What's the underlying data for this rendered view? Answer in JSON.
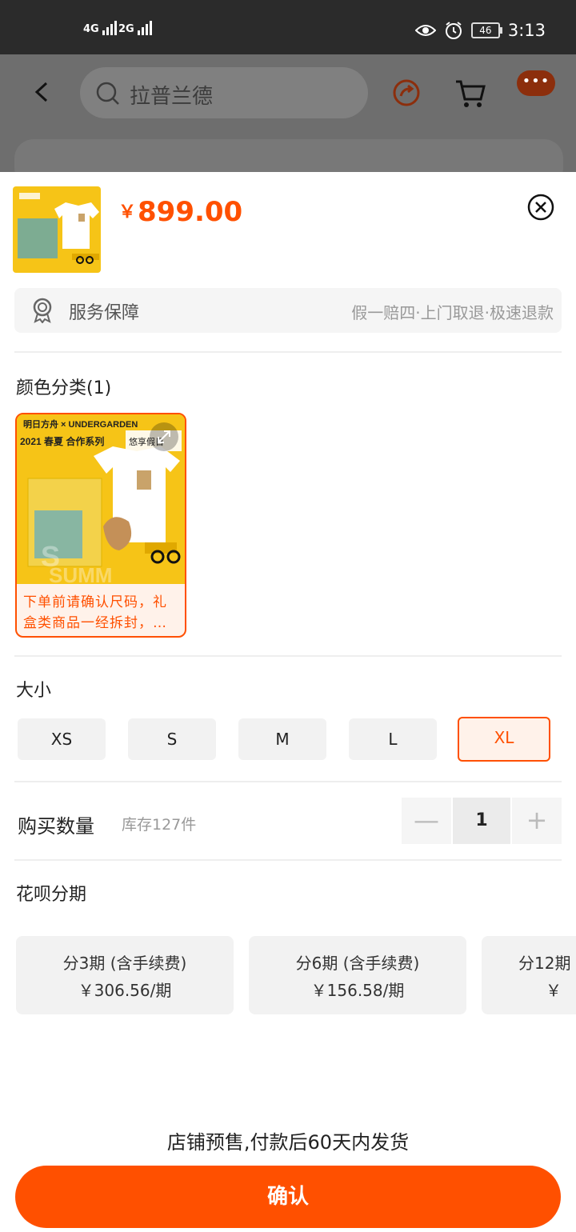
{
  "status_bar": {
    "net1": "4G",
    "net2": "2G",
    "battery": "46",
    "time": "3:13"
  },
  "bg_page": {
    "search_text": "拉普兰德"
  },
  "product": {
    "currency": "￥",
    "price": "899.00"
  },
  "service": {
    "label": "服务保障",
    "detail": "假一赔四·上门取退·极速退款"
  },
  "color": {
    "title": "颜色分类(1)",
    "option_text": "下单前请确认尺码，礼盒类商品一经拆封，…"
  },
  "size": {
    "title": "大小",
    "options": [
      "XS",
      "S",
      "M",
      "L",
      "XL"
    ],
    "selected": "XL"
  },
  "quantity": {
    "label": "购买数量",
    "stock": "库存127件",
    "value": "1",
    "minus": "—",
    "plus": "+"
  },
  "installment": {
    "title": "花呗分期",
    "options": [
      {
        "term": "分3期 (含手续费)",
        "amount": "￥306.56/期"
      },
      {
        "term": "分6期 (含手续费)",
        "amount": "￥156.58/期"
      },
      {
        "term": "分12期",
        "amount": "￥"
      }
    ]
  },
  "footer": {
    "presale_note": "店铺预售,付款后60天内发货",
    "confirm_label": "确认"
  },
  "colors": {
    "accent": "#ff5000",
    "accent_light": "#fff2ea"
  }
}
